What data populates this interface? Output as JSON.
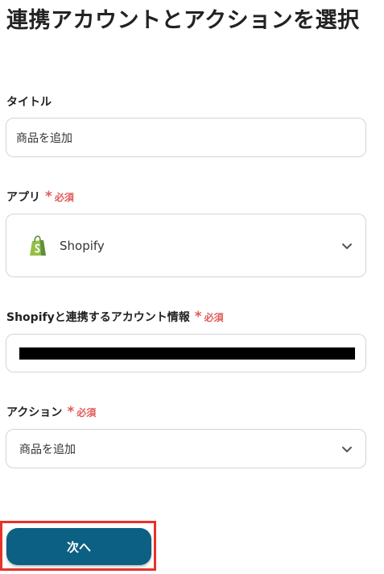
{
  "page": {
    "title": "連携アカウントとアクションを選択"
  },
  "fields": {
    "title_field": {
      "label": "タイトル",
      "value": "商品を追加"
    },
    "app_field": {
      "label": "アプリ",
      "required_label": "必須",
      "value": "Shopify",
      "icon": "shopify-bag-icon"
    },
    "account_field": {
      "label": "Shopifyと連携するアカウント情報",
      "required_label": "必須",
      "value_masked": true
    },
    "action_field": {
      "label": "アクション",
      "required_label": "必須",
      "value": "商品を追加"
    }
  },
  "actions": {
    "next_label": "次へ"
  },
  "colors": {
    "primary_button": "#0c6083",
    "required": "#e05a5a",
    "highlight_outline": "#e8322a",
    "shopify_green": "#95bf47"
  }
}
